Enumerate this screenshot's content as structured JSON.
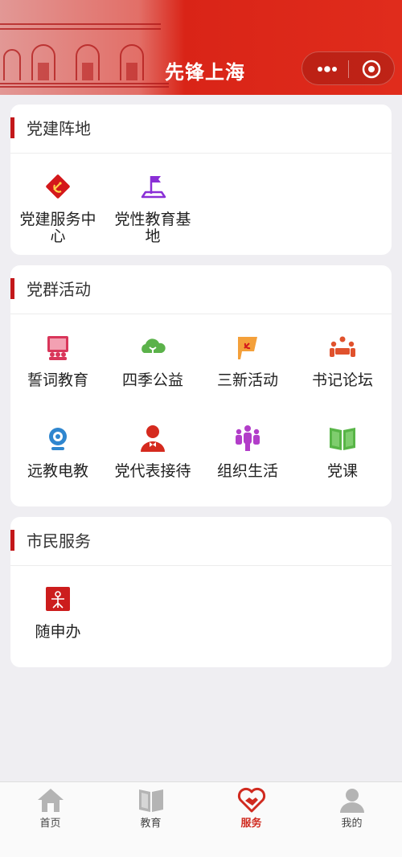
{
  "header": {
    "title": "先锋上海",
    "more_icon": "more-dots-icon",
    "close_icon": "target-circle-icon",
    "color": "#d92417"
  },
  "sections": [
    {
      "title": "党建阵地",
      "items": [
        {
          "label": "党建服务中心",
          "icon": "party-emblem-icon"
        },
        {
          "label": "党性教育基地",
          "icon": "flag-base-icon"
        }
      ]
    },
    {
      "title": "党群活动",
      "items": [
        {
          "label": "誓词教育",
          "icon": "presentation-icon"
        },
        {
          "label": "四季公益",
          "icon": "tree-sprout-icon"
        },
        {
          "label": "三新活动",
          "icon": "party-flag-icon"
        },
        {
          "label": "书记论坛",
          "icon": "meeting-table-icon"
        },
        {
          "label": "远教电教",
          "icon": "webcam-icon"
        },
        {
          "label": "党代表接待",
          "icon": "person-bowtie-icon"
        },
        {
          "label": "组织生活",
          "icon": "group-people-icon"
        },
        {
          "label": "党课",
          "icon": "open-book-icon"
        }
      ]
    },
    {
      "title": "市民服务",
      "items": [
        {
          "label": "随申办",
          "icon": "suishenban-logo-icon"
        }
      ]
    }
  ],
  "tabbar": {
    "active": "服务",
    "items": [
      {
        "label": "首页",
        "icon": "home-icon"
      },
      {
        "label": "教育",
        "icon": "book-icon"
      },
      {
        "label": "服务",
        "icon": "heart-handshake-icon"
      },
      {
        "label": "我的",
        "icon": "user-icon"
      }
    ]
  },
  "colors": {
    "accent": "#c3181a",
    "active_tab": "#d02a1f",
    "background": "#efeef2"
  }
}
